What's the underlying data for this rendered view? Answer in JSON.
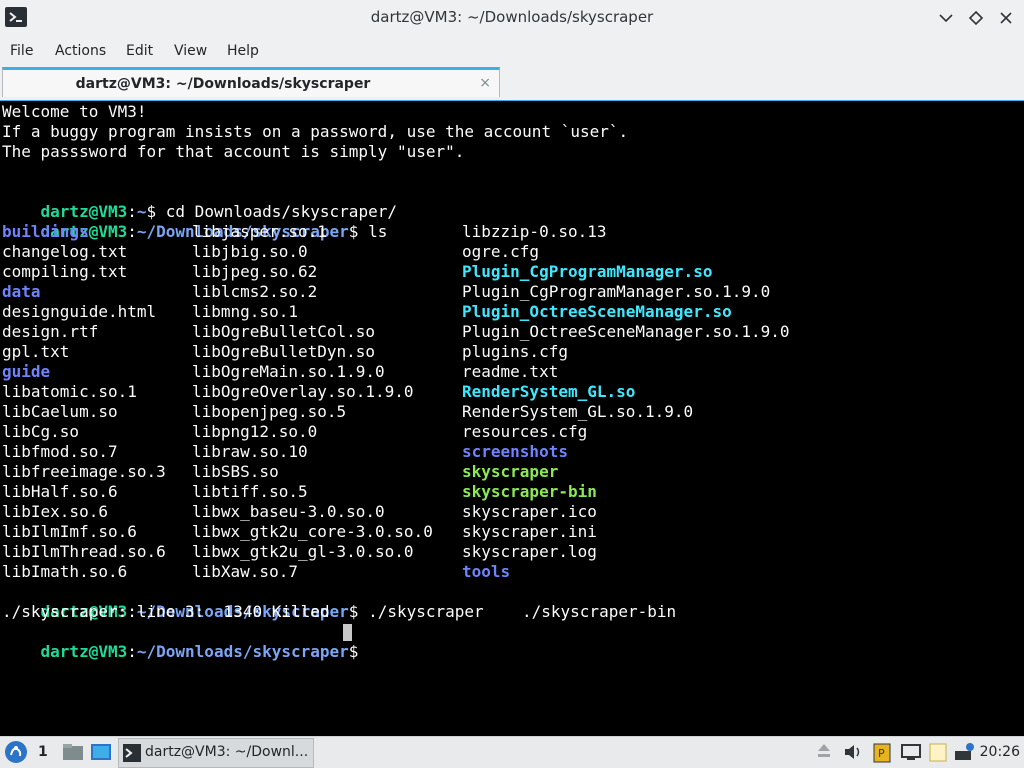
{
  "window": {
    "title": "dartz@VM3: ~/Downloads/skyscraper"
  },
  "menu": [
    "File",
    "Actions",
    "Edit",
    "View",
    "Help"
  ],
  "tab": {
    "label": "dartz@VM3: ~/Downloads/skyscraper",
    "close": "×"
  },
  "terminal": {
    "welcome": [
      "Welcome to VM3!",
      "If a buggy program insists on a password, use the account `user`.",
      "The passsword for that account is simply \"user\"."
    ],
    "prompts": [
      {
        "user": "dartz@VM3",
        "sep": ":",
        "path": "~",
        "end": "$ ",
        "cmd": "cd Downloads/skyscraper/"
      },
      {
        "user": "dartz@VM3",
        "sep": ":",
        "path": "~/Downloads/skyscraper",
        "end": "$ ",
        "cmd": "ls"
      },
      {
        "user": "dartz@VM3",
        "sep": ":",
        "path": "~/Downloads/skyscraper",
        "end": "$ ",
        "cmd": "./skyscraper"
      },
      {
        "user": "dartz@VM3",
        "sep": ":",
        "path": "~/Downloads/skyscraper",
        "end": "$ ",
        "cmd": ""
      }
    ],
    "ls_output": [
      [
        {
          "t": "buildings",
          "c": "dir"
        },
        {
          "t": "libjasper.so.1",
          "c": "file"
        },
        {
          "t": "libzzip-0.so.13",
          "c": "file"
        }
      ],
      [
        {
          "t": "changelog.txt",
          "c": "file"
        },
        {
          "t": "libjbig.so.0",
          "c": "file"
        },
        {
          "t": "ogre.cfg",
          "c": "file"
        }
      ],
      [
        {
          "t": "compiling.txt",
          "c": "file"
        },
        {
          "t": "libjpeg.so.62",
          "c": "file"
        },
        {
          "t": "Plugin_CgProgramManager.so",
          "c": "link"
        }
      ],
      [
        {
          "t": "data",
          "c": "dir"
        },
        {
          "t": "liblcms2.so.2",
          "c": "file"
        },
        {
          "t": "Plugin_CgProgramManager.so.1.9.0",
          "c": "file"
        }
      ],
      [
        {
          "t": "designguide.html",
          "c": "file"
        },
        {
          "t": "libmng.so.1",
          "c": "file"
        },
        {
          "t": "Plugin_OctreeSceneManager.so",
          "c": "link"
        }
      ],
      [
        {
          "t": "design.rtf",
          "c": "file"
        },
        {
          "t": "libOgreBulletCol.so",
          "c": "file"
        },
        {
          "t": "Plugin_OctreeSceneManager.so.1.9.0",
          "c": "file"
        }
      ],
      [
        {
          "t": "gpl.txt",
          "c": "file"
        },
        {
          "t": "libOgreBulletDyn.so",
          "c": "file"
        },
        {
          "t": "plugins.cfg",
          "c": "file"
        }
      ],
      [
        {
          "t": "guide",
          "c": "dir"
        },
        {
          "t": "libOgreMain.so.1.9.0",
          "c": "file"
        },
        {
          "t": "readme.txt",
          "c": "file"
        }
      ],
      [
        {
          "t": "libatomic.so.1",
          "c": "file"
        },
        {
          "t": "libOgreOverlay.so.1.9.0",
          "c": "file"
        },
        {
          "t": "RenderSystem_GL.so",
          "c": "link"
        }
      ],
      [
        {
          "t": "libCaelum.so",
          "c": "file"
        },
        {
          "t": "libopenjpeg.so.5",
          "c": "file"
        },
        {
          "t": "RenderSystem_GL.so.1.9.0",
          "c": "file"
        }
      ],
      [
        {
          "t": "libCg.so",
          "c": "file"
        },
        {
          "t": "libpng12.so.0",
          "c": "file"
        },
        {
          "t": "resources.cfg",
          "c": "file"
        }
      ],
      [
        {
          "t": "libfmod.so.7",
          "c": "file"
        },
        {
          "t": "libraw.so.10",
          "c": "file"
        },
        {
          "t": "screenshots",
          "c": "dir"
        }
      ],
      [
        {
          "t": "libfreeimage.so.3",
          "c": "file"
        },
        {
          "t": "libSBS.so",
          "c": "file"
        },
        {
          "t": "skyscraper",
          "c": "exec"
        }
      ],
      [
        {
          "t": "libHalf.so.6",
          "c": "file"
        },
        {
          "t": "libtiff.so.5",
          "c": "file"
        },
        {
          "t": "skyscraper-bin",
          "c": "exec"
        }
      ],
      [
        {
          "t": "libIex.so.6",
          "c": "file"
        },
        {
          "t": "libwx_baseu-3.0.so.0",
          "c": "file"
        },
        {
          "t": "skyscraper.ico",
          "c": "file"
        }
      ],
      [
        {
          "t": "libIlmImf.so.6",
          "c": "file"
        },
        {
          "t": "libwx_gtk2u_core-3.0.so.0",
          "c": "file"
        },
        {
          "t": "skyscraper.ini",
          "c": "file"
        }
      ],
      [
        {
          "t": "libIlmThread.so.6",
          "c": "file"
        },
        {
          "t": "libwx_gtk2u_gl-3.0.so.0",
          "c": "file"
        },
        {
          "t": "skyscraper.log",
          "c": "file"
        }
      ],
      [
        {
          "t": "libImath.so.6",
          "c": "file"
        },
        {
          "t": "libXaw.so.7",
          "c": "file"
        },
        {
          "t": "tools",
          "c": "dir"
        }
      ]
    ],
    "killed_line": {
      "prefix": "./skyscraper: line 3:  1340 Killed",
      "suffix": "./skyscraper-bin"
    }
  },
  "taskbar": {
    "workspace": "1",
    "task_label": "dartz@VM3: ~/Downl...",
    "clock": "20:26"
  },
  "colors": {
    "prompt_user": "#1cdc9a",
    "prompt_path": "#7aa6f5",
    "directory": "#6f83ff",
    "symlink": "#3ee9ff",
    "executable": "#8bea53",
    "accent": "#3daee9"
  }
}
